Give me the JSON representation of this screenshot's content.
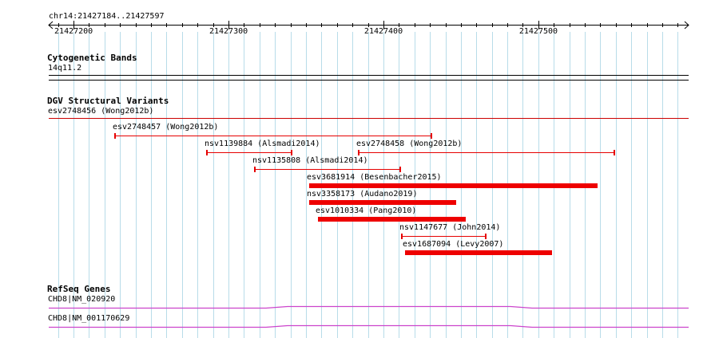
{
  "colors": {
    "grid": "#b8dce9",
    "cnv_line": "#e60000",
    "cnv_bar": "#ee0000",
    "gene": "#cc44cc",
    "track_sep": "#cc0000"
  },
  "ruler": {
    "region": "chr14:21427184..21427597",
    "ticks": [
      {
        "label": "21427200",
        "pos": 21427200
      },
      {
        "label": "21427300",
        "pos": 21427300
      },
      {
        "label": "21427400",
        "pos": 21427400
      },
      {
        "label": "21427500",
        "pos": 21427500
      }
    ]
  },
  "cytobands": {
    "title": "Cytogenetic Bands",
    "band": "14q11.2"
  },
  "dgv": {
    "title": "DGV Structural Variants",
    "top_label": "esv2748456 (Wong2012b)",
    "features": [
      {
        "label": "esv2748457 (Wong2012b)",
        "start": 21427227,
        "end": 21427431,
        "style": "line"
      },
      {
        "label": "nsv1139884 (Alsmadi2014)",
        "start": 21427286,
        "end": 21427341,
        "style": "line"
      },
      {
        "label": "esv2748458 (Wong2012b)",
        "start": 21427384,
        "end": 21427549,
        "style": "line"
      },
      {
        "label": "nsv1135808 (Alsmadi2014)",
        "start": 21427317,
        "end": 21427411,
        "style": "line"
      },
      {
        "label": "esv3681914 (Besenbacher2015)",
        "start": 21427352,
        "end": 21427538,
        "style": "bar"
      },
      {
        "label": "nsv3358173 (Audano2019)",
        "start": 21427352,
        "end": 21427447,
        "style": "bar"
      },
      {
        "label": "esv1010334 (Pang2010)",
        "start": 21427358,
        "end": 21427453,
        "style": "bar"
      },
      {
        "label": "nsv1147677 (John2014)",
        "start": 21427412,
        "end": 21427466,
        "style": "line"
      },
      {
        "label": "esv1687094 (Levy2007)",
        "start": 21427414,
        "end": 21427509,
        "style": "bar"
      }
    ]
  },
  "refseq": {
    "title": "RefSeq Genes",
    "genes": [
      {
        "label": "CHD8|NM_020920"
      },
      {
        "label": "CHD8|NM_001170629"
      }
    ]
  }
}
